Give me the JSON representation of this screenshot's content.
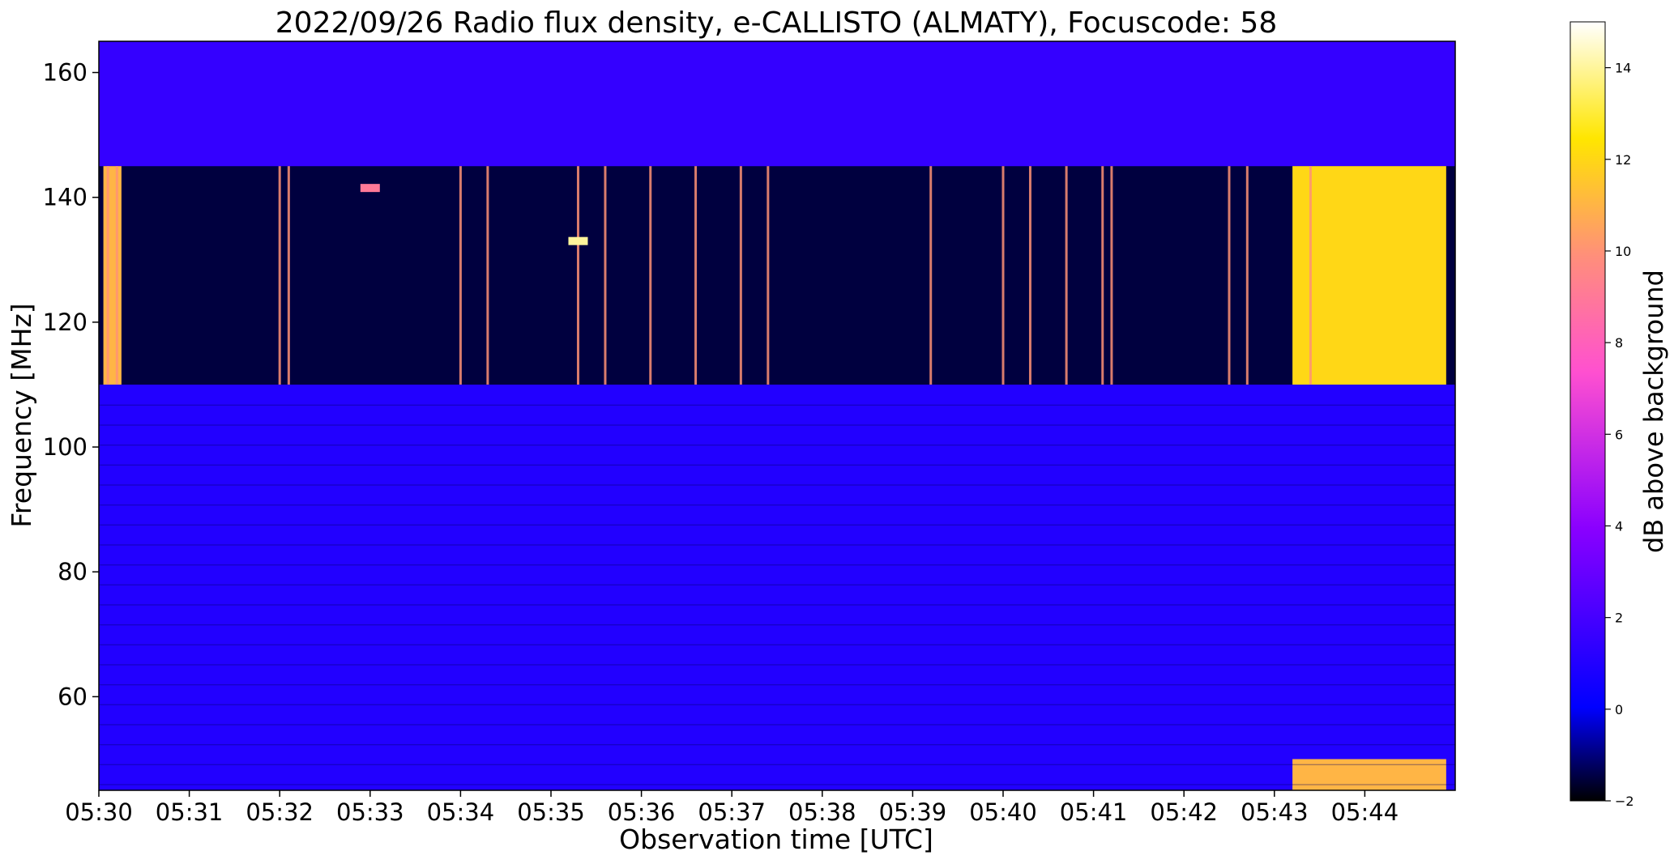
{
  "chart_data": {
    "type": "heatmap",
    "title": "2022/09/26  Radio flux density, e-CALLISTO (ALMATY), Focuscode: 58",
    "xlabel": "Observation time [UTC]",
    "ylabel": "Frequency [MHz]",
    "x_tick_labels": [
      "05:30",
      "05:31",
      "05:32",
      "05:33",
      "05:34",
      "05:35",
      "05:36",
      "05:37",
      "05:38",
      "05:39",
      "05:40",
      "05:41",
      "05:42",
      "05:43",
      "05:44"
    ],
    "x_range_minutes": [
      0,
      15
    ],
    "y_ticks": [
      60,
      80,
      100,
      120,
      140,
      160
    ],
    "y_range": [
      45,
      165
    ],
    "colorbar": {
      "label": "dB above background",
      "ticks": [
        -2,
        0,
        2,
        4,
        6,
        8,
        10,
        12,
        14
      ],
      "range": [
        -2,
        15
      ],
      "stops": [
        "#000000",
        "#0000ff",
        "#8a00ff",
        "#ff50d0",
        "#ff8f7a",
        "#ffe600",
        "#ffffff"
      ]
    },
    "regions": [
      {
        "feature": "background noise",
        "time_min": [
          0,
          15
        ],
        "freq_mhz": [
          45,
          110
        ],
        "db": 1
      },
      {
        "feature": "quiet band",
        "time_min": [
          0,
          15
        ],
        "freq_mhz": [
          110,
          145
        ],
        "db": -1.5
      },
      {
        "feature": "band edge noise",
        "time_min": [
          0,
          15
        ],
        "freq_mhz": [
          145,
          165
        ],
        "db": 1.5
      },
      {
        "feature": "burst (broadband emission)",
        "time_min": [
          0.05,
          0.25
        ],
        "freq_mhz": [
          110,
          145
        ],
        "db": 11
      },
      {
        "feature": "burst (broadband emission)",
        "time_min": [
          13.2,
          14.9
        ],
        "freq_mhz": [
          110,
          145
        ],
        "db": 12
      },
      {
        "feature": "burst (low band)",
        "time_min": [
          13.2,
          14.9
        ],
        "freq_mhz": [
          45,
          50
        ],
        "db": 11
      }
    ],
    "spikes_time_min": [
      0.1,
      0.2,
      2.0,
      2.1,
      4.0,
      4.3,
      5.3,
      5.6,
      6.1,
      6.6,
      7.1,
      7.4,
      9.2,
      10.0,
      10.3,
      10.7,
      11.1,
      11.2,
      12.5,
      12.7,
      13.4
    ],
    "hot_spots": [
      {
        "time_min": 5.3,
        "freq_mhz": 133,
        "db": 14
      },
      {
        "time_min": 3.0,
        "freq_mhz": 141.5,
        "db": 9
      }
    ]
  }
}
